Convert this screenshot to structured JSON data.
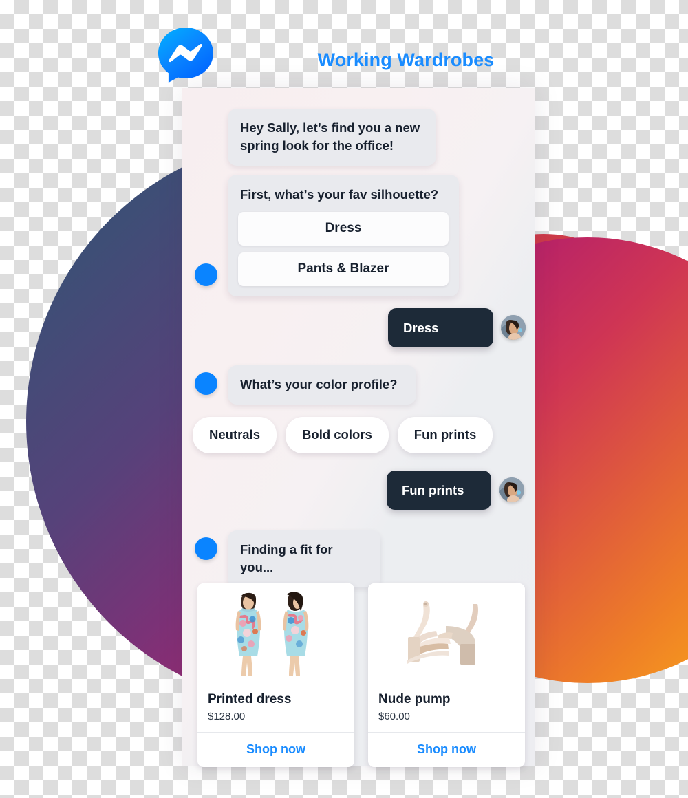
{
  "header": {
    "logo_icon": "messenger-logo-icon",
    "title": "Working Wardrobes",
    "title_color": "#1a8cff"
  },
  "conversation": {
    "bot_indicator_icon": "bot-avatar-dot",
    "messages": [
      {
        "sender": "bot",
        "type": "text",
        "text": "Hey Sally, let’s find you a new spring look for the office!"
      },
      {
        "sender": "bot",
        "type": "question_card",
        "question": "First, what’s your fav silhouette?",
        "options": [
          "Dress",
          "Pants & Blazer"
        ]
      },
      {
        "sender": "user",
        "type": "text",
        "text": "Dress"
      },
      {
        "sender": "bot",
        "type": "text",
        "text": "What’s your color profile?"
      },
      {
        "sender": "bot",
        "type": "quick_replies",
        "options": [
          "Neutrals",
          "Bold colors",
          "Fun prints"
        ]
      },
      {
        "sender": "user",
        "type": "text",
        "text": "Fun prints"
      },
      {
        "sender": "bot",
        "type": "text",
        "text": "Finding a fit for you..."
      }
    ]
  },
  "products": [
    {
      "name": "Printed dress",
      "price": "$128.00",
      "cta": "Shop now",
      "image_alt": "two models wearing a light blue floral printed sleeveless sheath dress"
    },
    {
      "name": "Nude pump",
      "price": "$60.00",
      "cta": "Shop now",
      "image_alt": "pair of nude beige block-heel ankle strap sandals"
    }
  ],
  "colors": {
    "accent_blue": "#1a8cff",
    "bot_dot_blue": "#0a84ff",
    "user_bubble": "#1d2a38",
    "bot_bubble": "#e9eaee",
    "text_dark": "#17202e",
    "circle_big_from": "#2d4a6b",
    "circle_big_to": "#d9504a",
    "circle_small_from": "#9c1f7a",
    "circle_small_to": "#fbb316"
  }
}
